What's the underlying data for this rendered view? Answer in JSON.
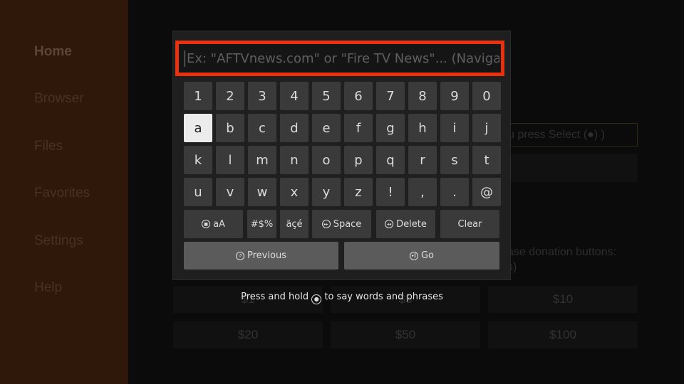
{
  "sidebar": {
    "items": [
      {
        "label": "Home",
        "active": true
      },
      {
        "label": "Browser"
      },
      {
        "label": "Files"
      },
      {
        "label": "Favorites"
      },
      {
        "label": "Settings"
      },
      {
        "label": "Help"
      }
    ]
  },
  "background": {
    "url_hint": "u press Select (●) )",
    "donation_text": "ase donation buttons:",
    "donation_text2": "s)",
    "donations": [
      "$1",
      "$5",
      "$10",
      "$20",
      "$50",
      "$100"
    ]
  },
  "keyboard": {
    "placeholder": "Ex: \"AFTVnews.com\" or \"Fire TV News\"... (Navigat",
    "value": "",
    "rows": [
      [
        "1",
        "2",
        "3",
        "4",
        "5",
        "6",
        "7",
        "8",
        "9",
        "0"
      ],
      [
        "a",
        "b",
        "c",
        "d",
        "e",
        "f",
        "g",
        "h",
        "i",
        "j"
      ],
      [
        "k",
        "l",
        "m",
        "n",
        "o",
        "p",
        "q",
        "r",
        "s",
        "t"
      ],
      [
        "u",
        "v",
        "w",
        "x",
        "y",
        "z",
        "!",
        ",",
        ".",
        "@"
      ]
    ],
    "selected_key": "a",
    "case_label": "aA",
    "symbols_label": "#$%",
    "accents_label": "äçé",
    "space_label": "Space",
    "delete_label": "Delete",
    "clear_label": "Clear",
    "previous_label": "Previous",
    "go_label": "Go",
    "voice_hint_before": "Press and hold",
    "voice_hint_after": "to say words and phrases",
    "accent_color": "#e8310f"
  }
}
